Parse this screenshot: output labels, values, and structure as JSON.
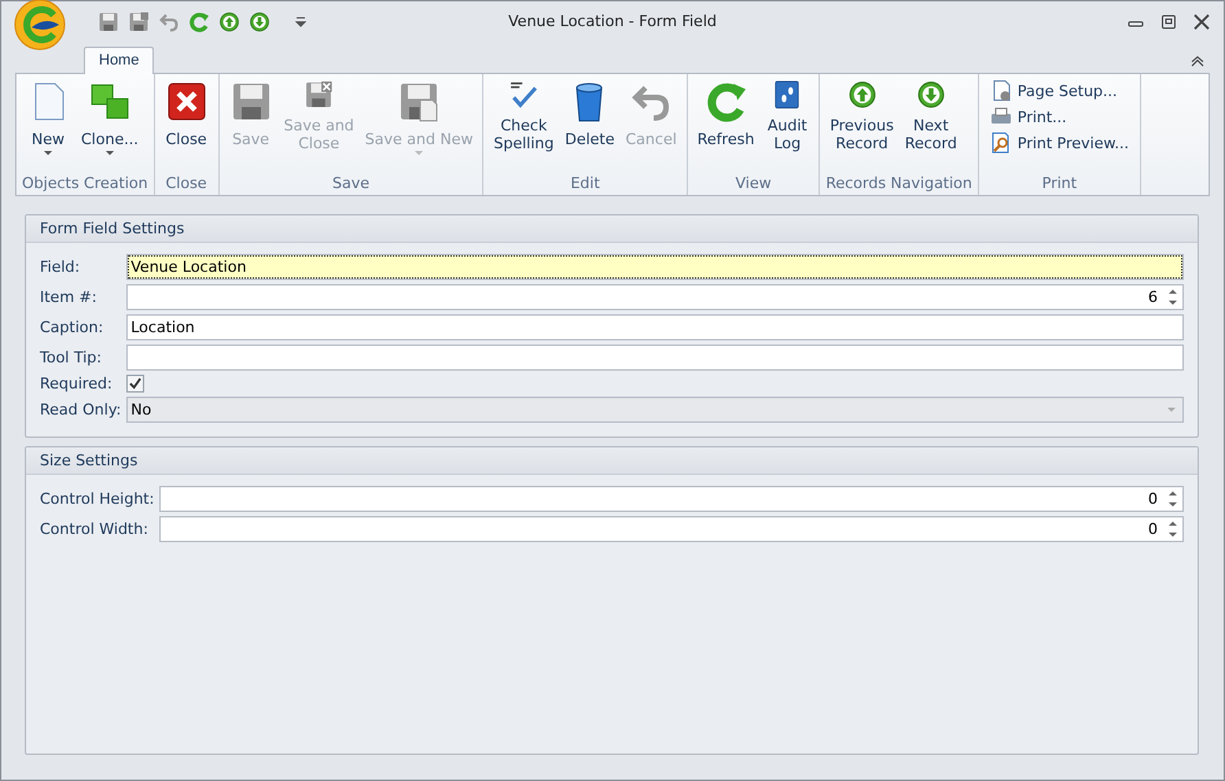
{
  "window": {
    "title": "Venue Location - Form Field"
  },
  "tabs": [
    {
      "label": "Home",
      "selected": true
    }
  ],
  "ribbon": {
    "groups": [
      {
        "label": "Objects Creation",
        "buttons": [
          {
            "label": "New",
            "disabled": false,
            "dropdown": true
          },
          {
            "label": "Clone...",
            "disabled": false,
            "dropdown": true
          }
        ]
      },
      {
        "label": "Close",
        "buttons": [
          {
            "label": "Close",
            "disabled": false,
            "dropdown": false
          }
        ]
      },
      {
        "label": "Save",
        "buttons": [
          {
            "label": "Save",
            "disabled": true,
            "dropdown": false
          },
          {
            "label": "Save and Close",
            "disabled": true,
            "dropdown": false
          },
          {
            "label": "Save and New",
            "disabled": true,
            "dropdown": true
          }
        ]
      },
      {
        "label": "Edit",
        "buttons": [
          {
            "label": "Check Spelling",
            "disabled": false,
            "dropdown": false
          },
          {
            "label": "Delete",
            "disabled": false,
            "dropdown": false
          },
          {
            "label": "Cancel",
            "disabled": true,
            "dropdown": false
          }
        ]
      },
      {
        "label": "View",
        "buttons": [
          {
            "label": "Refresh",
            "disabled": false,
            "dropdown": false
          },
          {
            "label": "Audit Log",
            "disabled": false,
            "dropdown": false
          }
        ]
      },
      {
        "label": "Records Navigation",
        "buttons": [
          {
            "label": "Previous Record",
            "disabled": false,
            "dropdown": false
          },
          {
            "label": "Next Record",
            "disabled": false,
            "dropdown": false
          }
        ]
      },
      {
        "label": "Print",
        "small_buttons": [
          {
            "label": "Page Setup..."
          },
          {
            "label": "Print..."
          },
          {
            "label": "Print Preview..."
          }
        ]
      }
    ]
  },
  "sections": [
    {
      "title": "Form Field Settings",
      "fields": [
        {
          "label": "Field:",
          "kind": "text",
          "value": "Venue Location",
          "focused": true
        },
        {
          "label": "Item #:",
          "kind": "spin",
          "value": "6",
          "focused": false
        },
        {
          "label": "Caption:",
          "kind": "text",
          "value": "Location",
          "focused": false
        },
        {
          "label": "Tool Tip:",
          "kind": "text",
          "focused": false
        },
        {
          "label": "Required:",
          "kind": "checkbox",
          "checked": true
        },
        {
          "label": "Read Only:",
          "kind": "combo",
          "value": "No",
          "disabled": true
        }
      ]
    },
    {
      "title": "Size Settings",
      "fields": [
        {
          "label": "Control Height:",
          "kind": "spin",
          "value": "0",
          "focused": false
        },
        {
          "label": "Control Width:",
          "kind": "spin",
          "value": "0",
          "focused": false
        }
      ]
    }
  ]
}
